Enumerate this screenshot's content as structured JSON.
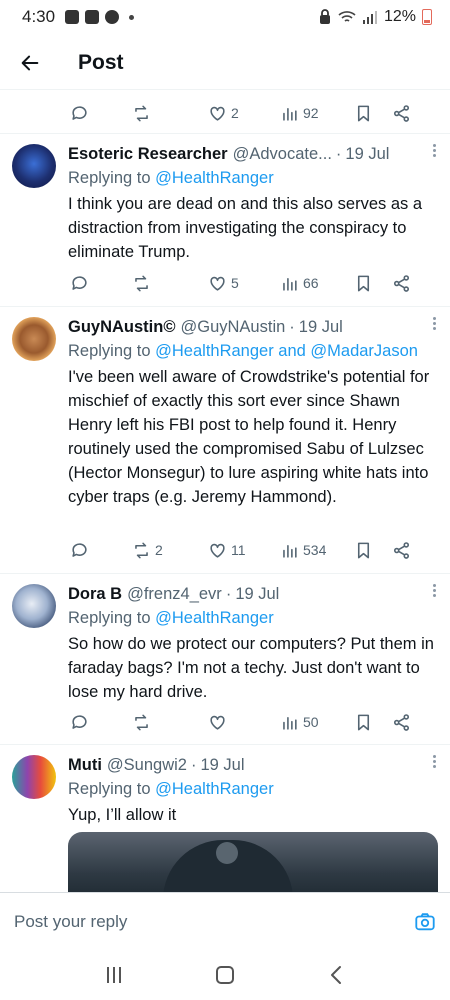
{
  "status_bar": {
    "time": "4:30",
    "battery": "12%"
  },
  "header": {
    "title": "Post"
  },
  "top_actions": {
    "likes": "2",
    "views": "92"
  },
  "replies": [
    {
      "name": "Esoteric Researcher",
      "handle": "@Advocate...",
      "date": "19 Jul",
      "replying_prefix": "Replying to ",
      "replying_to": "@HealthRanger",
      "text": "I think you are dead on and this also serves as a distraction from investigating the conspiracy to eliminate Trump.",
      "retweets": "",
      "likes": "5",
      "views": "66"
    },
    {
      "name": "GuyNAustin©",
      "handle": "@GuyNAustin",
      "date": "19 Jul",
      "replying_prefix": "Replying to ",
      "replying_to": "@HealthRanger and @MadarJason",
      "text": "I've been well aware of Crowdstrike's potential for mischief of exactly this sort ever since Shawn Henry left his FBI post to help found it. Henry routinely used the compromised Sabu of Lulzsec (Hector Monsegur) to lure aspiring white hats into cyber traps (e.g. Jeremy Hammond).",
      "retweets": "2",
      "likes": "11",
      "views": "534"
    },
    {
      "name": "Dora B",
      "handle": "@frenz4_evr",
      "date": "19 Jul",
      "replying_prefix": "Replying to ",
      "replying_to": "@HealthRanger",
      "text": "So how do we protect our computers?  Put them in faraday bags?  I'm not a techy.  Just don't want to lose my hard drive.",
      "retweets": "",
      "likes": "",
      "views": "50"
    },
    {
      "name": "Muti",
      "handle": "@Sungwi2",
      "date": "19 Jul",
      "replying_prefix": "Replying to ",
      "replying_to": "@HealthRanger",
      "text": "Yup, I’ll allow it"
    }
  ],
  "composer": {
    "placeholder": "Post your reply"
  },
  "colors": {
    "link": "#1d9bf0",
    "muted": "#536471",
    "text": "#0f1419"
  }
}
